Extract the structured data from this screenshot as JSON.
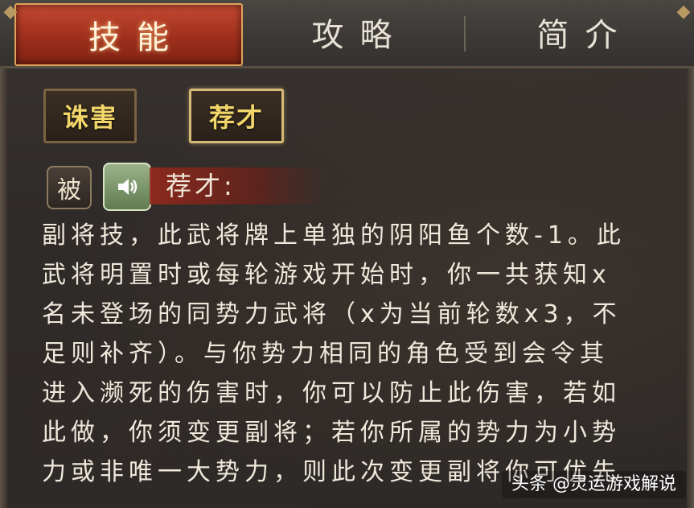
{
  "tabs": [
    {
      "label": "技能"
    },
    {
      "label": "攻略"
    },
    {
      "label": "简介"
    }
  ],
  "skill_buttons": [
    {
      "label": "诛害"
    },
    {
      "label": "荐才"
    }
  ],
  "skill": {
    "type_label": "被",
    "voice_icon": "speaker-icon",
    "name": "荐才:",
    "description_lines": [
      "副将技，此武将牌上单独的阴阳鱼个数-1。此",
      "武将明置时或每轮游戏开始时，你一共获知x",
      "名未登场的同势力武将（x为当前轮数x3，不",
      "足则补齐）。与你势力相同的角色受到会令其",
      "进入濒死的伤害时，你可以防止此伤害，若如",
      "此做，你须变更副将；若你所属的势力为小势",
      "力或非唯一大势力，则此次变更副将你可优先"
    ]
  },
  "watermark": "头条 @灵运游戏解说",
  "colors": {
    "active_tab": "#a8321e",
    "skill_text": "#f2d66a",
    "description_text": "#efe9dc",
    "background": "#2e2a27"
  }
}
